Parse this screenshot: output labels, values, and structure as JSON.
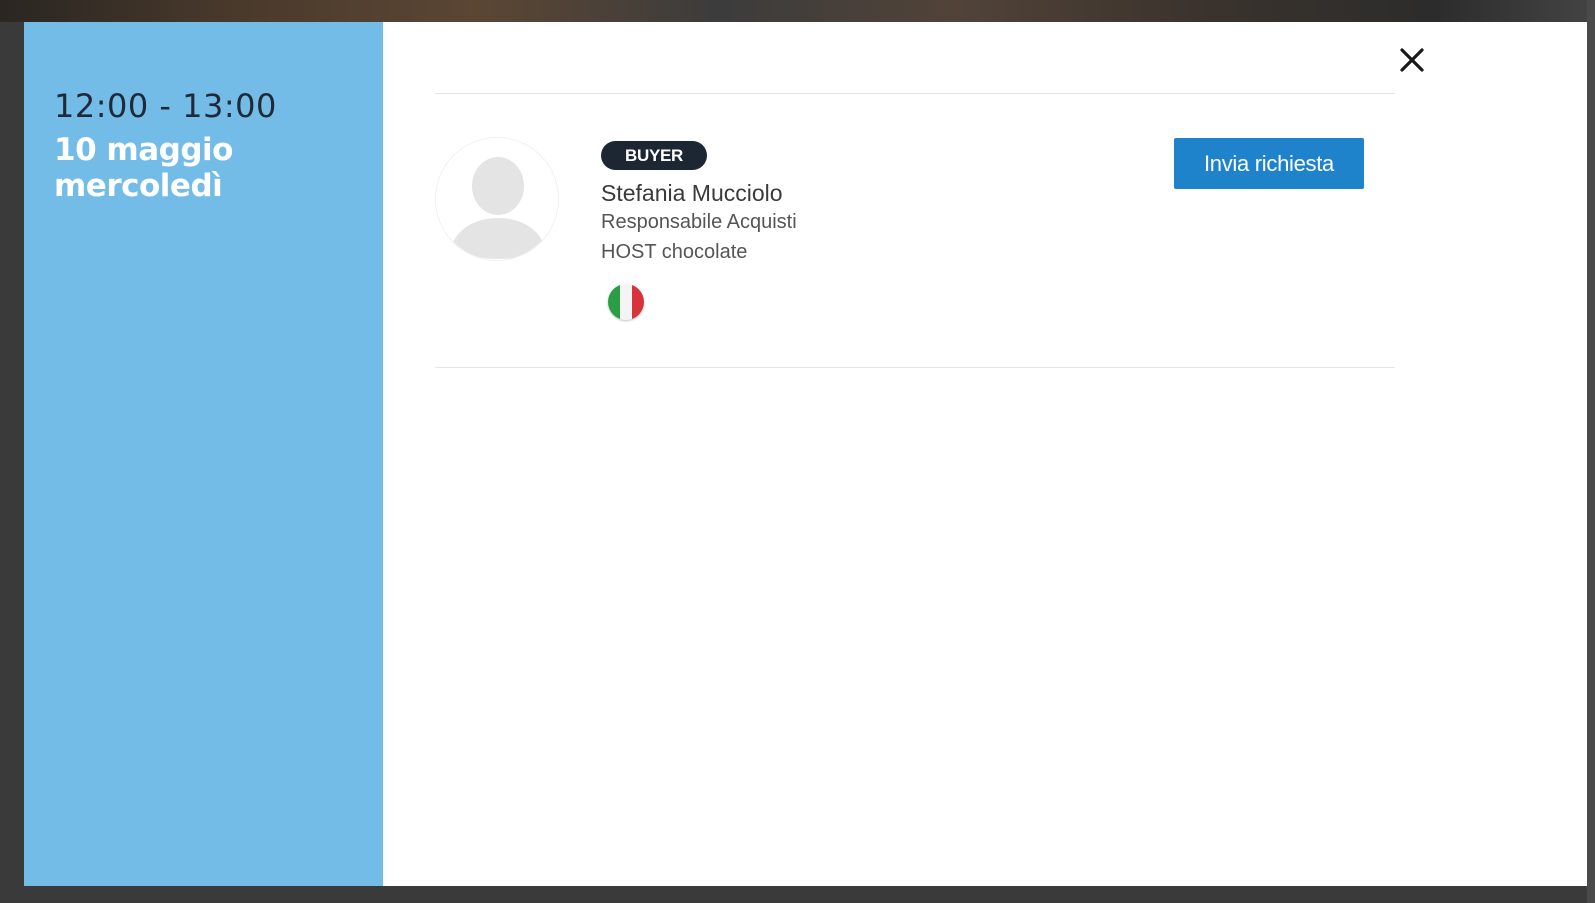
{
  "slot": {
    "time_range": "12:00 - 13:00",
    "date_day": "10 maggio",
    "weekday": "mercoledì"
  },
  "attendee": {
    "role_badge": "BUYER",
    "name": "Stefania Mucciolo",
    "title": "Responsabile Acquisti",
    "company": "HOST chocolate",
    "country_flag_icon": "italy-flag-icon",
    "avatar_icon": "user-placeholder-icon"
  },
  "actions": {
    "send_request_label": "Invia richiesta",
    "close_icon": "close-icon"
  },
  "colors": {
    "side_panel": "#74bce8",
    "primary_button": "#1f83cc",
    "badge": "#1c2733"
  }
}
